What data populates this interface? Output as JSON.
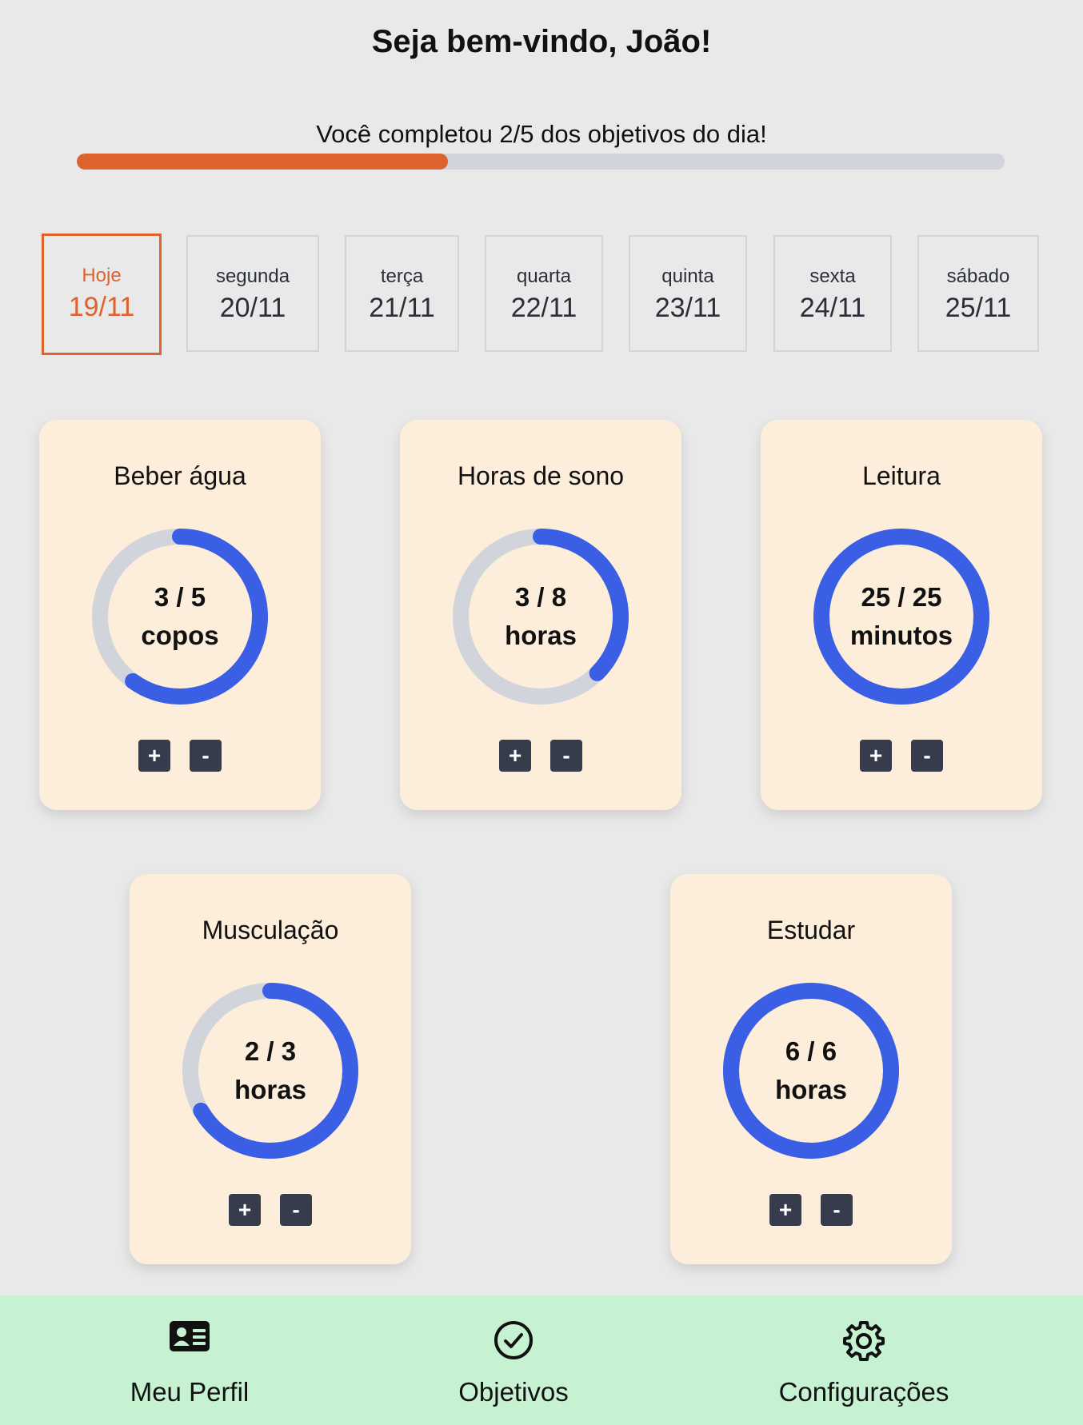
{
  "header": {
    "greeting": "Seja bem-vindo, João!",
    "progress_text": "Você completou 2/5 dos objetivos do dia!",
    "progress_fraction": 0.4
  },
  "days": [
    {
      "name": "Hoje",
      "date": "19/11",
      "active": true
    },
    {
      "name": "segunda",
      "date": "20/11",
      "active": false
    },
    {
      "name": "terça",
      "date": "21/11",
      "active": false
    },
    {
      "name": "quarta",
      "date": "22/11",
      "active": false
    },
    {
      "name": "quinta",
      "date": "23/11",
      "active": false
    },
    {
      "name": "sexta",
      "date": "24/11",
      "active": false
    },
    {
      "name": "sábado",
      "date": "25/11",
      "active": false
    }
  ],
  "goals": [
    {
      "title": "Beber água",
      "current": 3,
      "target": 5,
      "amount": "3 / 5",
      "unit": "copos",
      "plus_label": "+",
      "minus_label": "-"
    },
    {
      "title": "Horas de sono",
      "current": 3,
      "target": 8,
      "amount": "3 / 8",
      "unit": "horas",
      "plus_label": "+",
      "minus_label": "-"
    },
    {
      "title": "Leitura",
      "current": 25,
      "target": 25,
      "amount": "25 / 25",
      "unit": "minutos",
      "plus_label": "+",
      "minus_label": "-"
    },
    {
      "title": "Musculação",
      "current": 2,
      "target": 3,
      "amount": "2 / 3",
      "unit": "horas",
      "plus_label": "+",
      "minus_label": "-"
    },
    {
      "title": "Estudar",
      "current": 6,
      "target": 6,
      "amount": "6 / 6",
      "unit": "horas",
      "plus_label": "+",
      "minus_label": "-"
    }
  ],
  "nav": [
    {
      "label": "Meu Perfil",
      "icon": "profile-card-icon"
    },
    {
      "label": "Objetivos",
      "icon": "check-circle-icon"
    },
    {
      "label": "Configurações",
      "icon": "gear-icon"
    }
  ],
  "colors": {
    "accent": "#de622e",
    "ring": "#3a5fe5",
    "ring_track": "#d1d5db",
    "card": "#fdeedb",
    "navbar": "#c6f2d2",
    "button": "#363c4b"
  }
}
